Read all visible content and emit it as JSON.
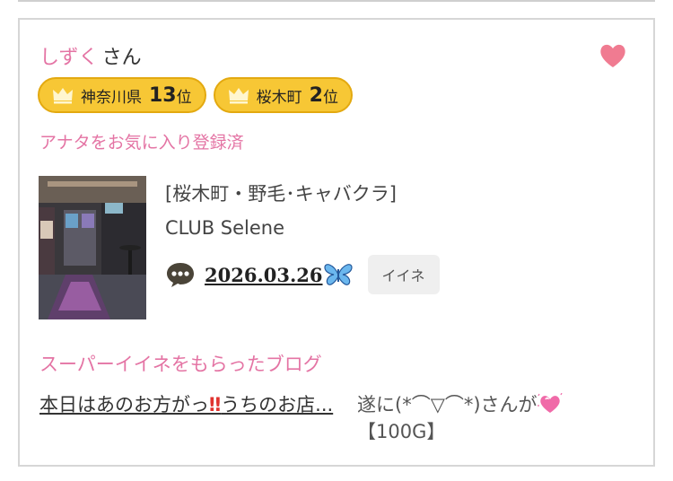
{
  "user": {
    "name": "しずく",
    "suffix": "さん"
  },
  "badges": [
    {
      "area": "神奈川県",
      "rank": "13",
      "unit": "位"
    },
    {
      "area": "桜木町",
      "rank": "2",
      "unit": "位"
    }
  ],
  "favorite_status": "アナタをお気に入り登録済",
  "shop": {
    "area": "[桜木町・野毛･キャバクラ]",
    "name": "CLUB Selene"
  },
  "post": {
    "date": "2026.03.26",
    "like_button": "イイネ"
  },
  "super_like": {
    "heading": "スーパーイイネをもらったブログ",
    "blog_title_part1": "本日はあのお方がっ",
    "blog_title_bang": "‼",
    "blog_title_part2": "うちのお店...",
    "excerpt_part1": "遂に(*⌒▽⌒*)さんが",
    "excerpt_part2": "【100G】"
  },
  "colors": {
    "pink": "#e474a4",
    "badge_gold": "#f7c735",
    "heart": "#f07b91"
  },
  "icons": {
    "heart": "heart-icon",
    "crown": "crown-icon",
    "comment": "comment-icon",
    "butterfly": "butterfly-icon",
    "sparkle_heart": "sparkling-heart-icon"
  }
}
